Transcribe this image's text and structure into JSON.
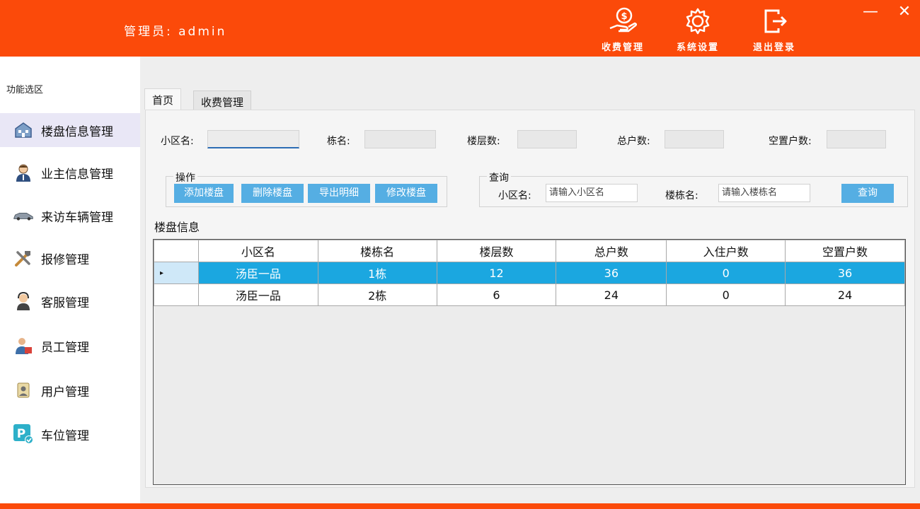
{
  "header": {
    "admin_label": "管理员:  admin",
    "actions": [
      {
        "label": "收费管理",
        "icon": "money-hand-icon"
      },
      {
        "label": "系统设置",
        "icon": "gear-icon"
      },
      {
        "label": "退出登录",
        "icon": "logout-icon"
      }
    ],
    "minimize": "—",
    "close": "✕",
    "brand_color": "#fb4a0a"
  },
  "sidebar": {
    "title": "功能选区",
    "items": [
      {
        "label": "楼盘信息管理",
        "icon": "building-icon",
        "active": true
      },
      {
        "label": "业主信息管理",
        "icon": "owner-icon"
      },
      {
        "label": "来访车辆管理",
        "icon": "car-icon"
      },
      {
        "label": "报修管理",
        "icon": "tools-icon"
      },
      {
        "label": "客服管理",
        "icon": "service-icon"
      },
      {
        "label": "员工管理",
        "icon": "staff-icon"
      },
      {
        "label": "用户管理",
        "icon": "user-icon"
      },
      {
        "label": "车位管理",
        "icon": "parking-icon"
      }
    ]
  },
  "tabs": [
    {
      "label": "首页",
      "active": true
    },
    {
      "label": "收费管理",
      "active": false
    }
  ],
  "fields": {
    "community_label": "小区名:",
    "building_label": "栋名:",
    "floors_label": "楼层数:",
    "households_label": "总户数:",
    "vacant_label": "空置户数:"
  },
  "operations": {
    "title": "操作",
    "buttons": [
      "添加楼盘",
      "删除楼盘",
      "导出明细",
      "修改楼盘"
    ]
  },
  "query": {
    "title": "查询",
    "community_label": "小区名:",
    "community_placeholder": "请输入小区名",
    "building_label": "楼栋名:",
    "building_placeholder": "请输入楼栋名",
    "button": "查询"
  },
  "table": {
    "title": "楼盘信息",
    "columns": [
      "小区名",
      "楼栋名",
      "楼层数",
      "总户数",
      "入住户数",
      "空置户数"
    ],
    "rows": [
      [
        "汤臣一品",
        "1栋",
        "12",
        "36",
        "0",
        "36"
      ],
      [
        "汤臣一品",
        "2栋",
        "6",
        "24",
        "0",
        "24"
      ]
    ],
    "selected_row_marker": "▸",
    "selected_color": "#1ba7e0"
  }
}
